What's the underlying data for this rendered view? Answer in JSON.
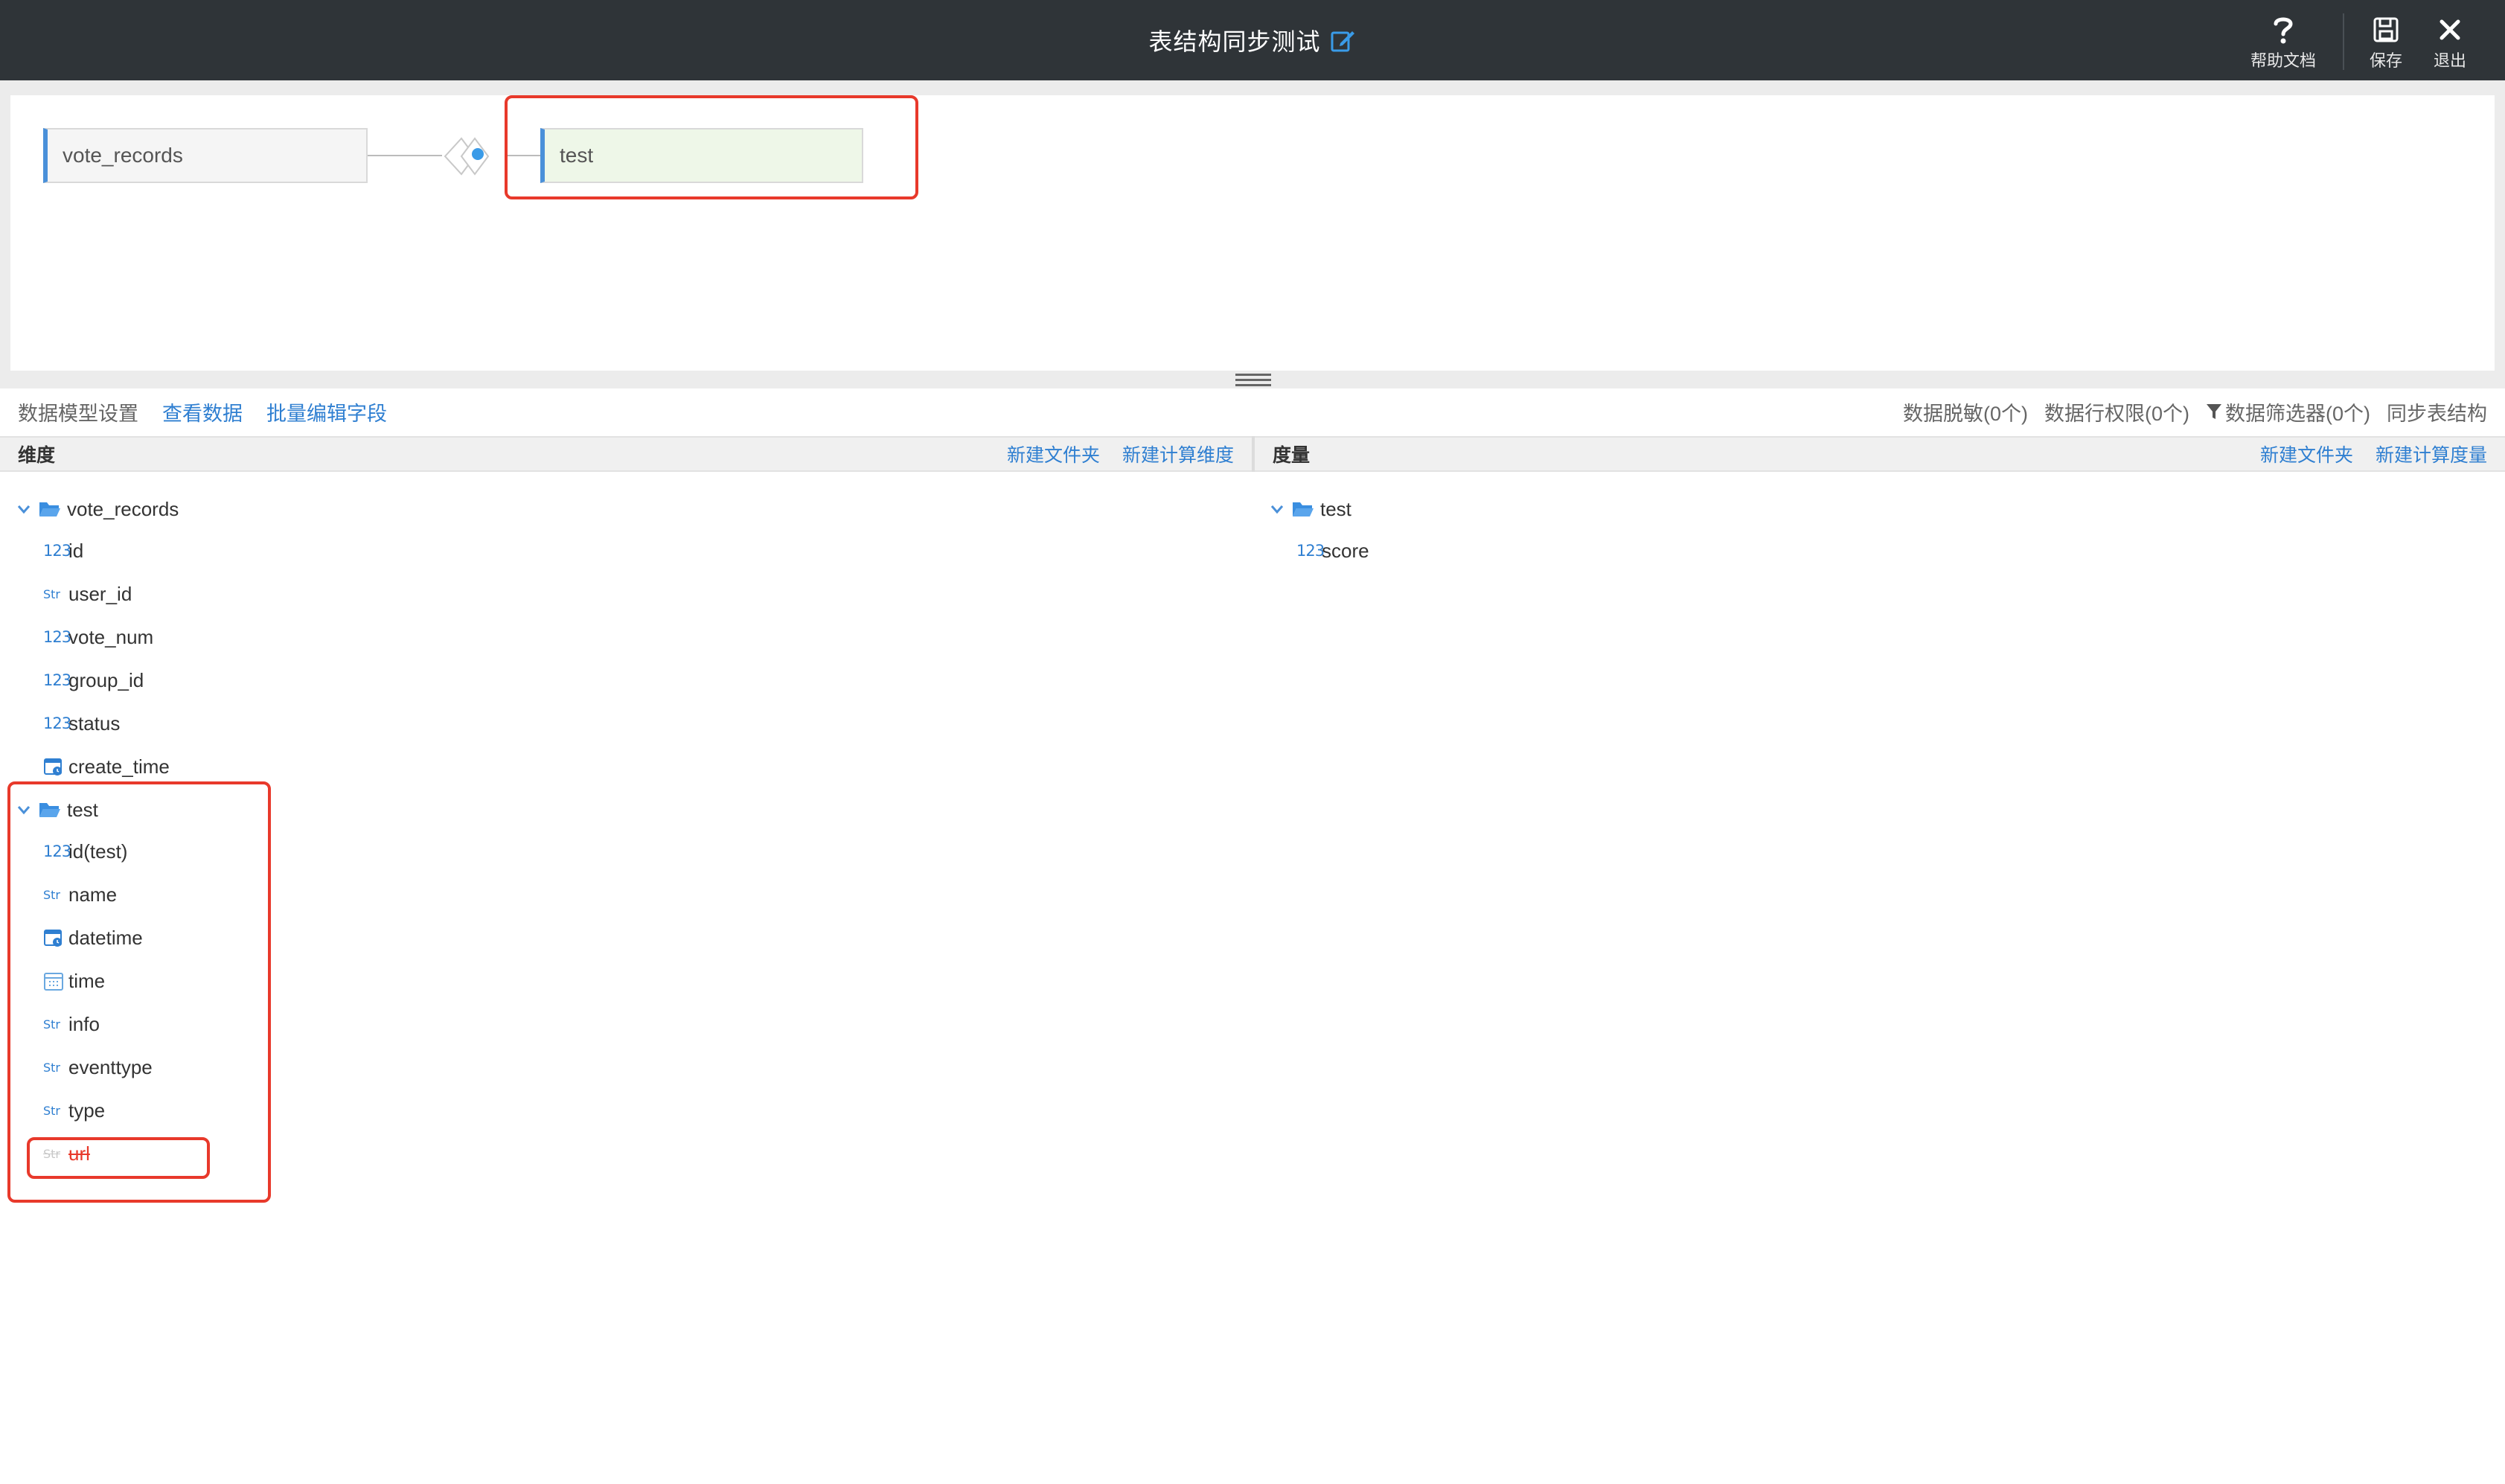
{
  "topbar": {
    "title": "表结构同步测试",
    "tools": {
      "help_label": "帮助文档",
      "save_label": "保存",
      "exit_label": "退出"
    }
  },
  "canvas": {
    "main_table": "vote_records",
    "joined_table": "test"
  },
  "actionbar": {
    "left": {
      "model_settings": "数据模型设置",
      "view_data": "查看数据",
      "batch_edit": "批量编辑字段"
    },
    "right": {
      "masking": "数据脱敏(0个)",
      "row_permission": "数据行权限(0个)",
      "filter": "数据筛选器(0个)",
      "sync": "同步表结构"
    }
  },
  "dimensions": {
    "title": "维度",
    "new_folder": "新建文件夹",
    "new_calc": "新建计算维度",
    "groups": [
      {
        "name": "vote_records",
        "fields": [
          {
            "type": "123",
            "name": "id"
          },
          {
            "type": "Str",
            "name": "user_id"
          },
          {
            "type": "123",
            "name": "vote_num"
          },
          {
            "type": "123",
            "name": "group_id"
          },
          {
            "type": "123",
            "name": "status"
          },
          {
            "type": "datetime",
            "name": "create_time"
          }
        ]
      },
      {
        "name": "test",
        "fields": [
          {
            "type": "123",
            "name": "id(test)"
          },
          {
            "type": "Str",
            "name": "name"
          },
          {
            "type": "datetime",
            "name": "datetime"
          },
          {
            "type": "date",
            "name": "time"
          },
          {
            "type": "Str",
            "name": "info"
          },
          {
            "type": "Str",
            "name": "eventtype"
          },
          {
            "type": "Str",
            "name": "type"
          },
          {
            "type": "Str",
            "name": "url",
            "deleted": true
          }
        ]
      }
    ]
  },
  "measures": {
    "title": "度量",
    "new_folder": "新建文件夹",
    "new_calc": "新建计算度量",
    "groups": [
      {
        "name": "test",
        "fields": [
          {
            "type": "123",
            "name": "score"
          }
        ]
      }
    ]
  },
  "colors": {
    "topbar": "#2f3438",
    "link": "#2f7fd1",
    "highlight": "#e8392b",
    "node_accent": "#4a90d9"
  }
}
